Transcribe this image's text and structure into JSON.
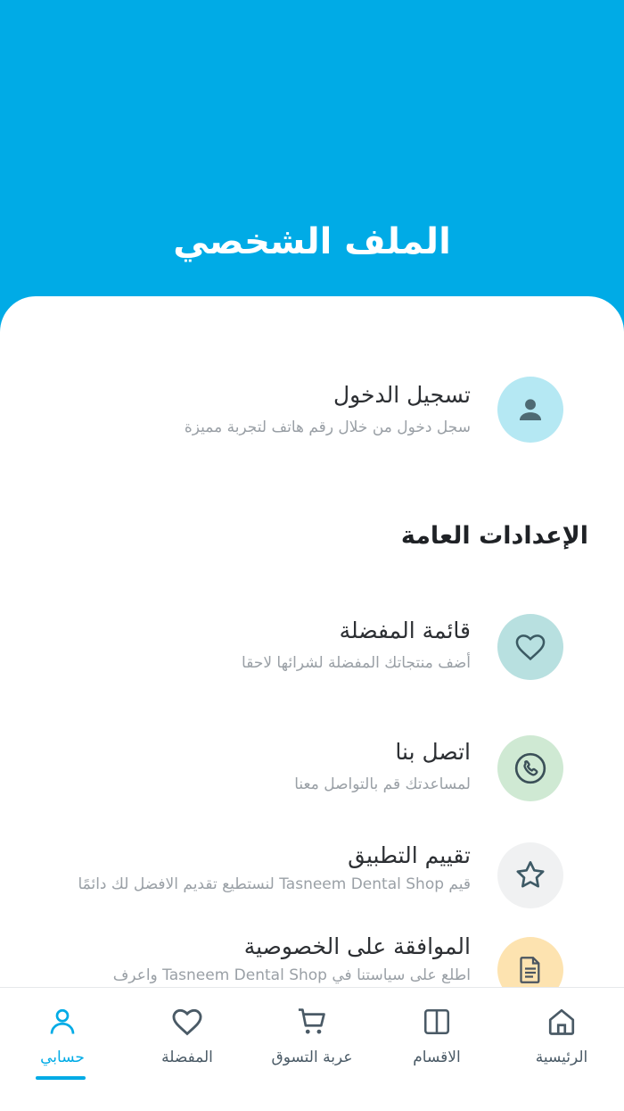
{
  "header": {
    "title": "الملف الشخصي"
  },
  "login": {
    "title": "تسجيل الدخول",
    "subtitle": "سجل دخول من خلال رقم هاتف لتجربة مميزة"
  },
  "general_settings": {
    "title": "الإعدادات العامة"
  },
  "items": [
    {
      "title": "قائمة المفضلة",
      "subtitle": "أضف منتجاتك المفضلة لشرائها لاحقا",
      "icon": "heart-icon",
      "color": "#b8e0e0"
    },
    {
      "title": "اتصل بنا",
      "subtitle": "لمساعدتك قم بالتواصل معنا",
      "icon": "phone-icon",
      "color": "#cfe9d3"
    },
    {
      "title": "تقييم التطبيق",
      "subtitle": "قيم Tasneem Dental Shop لنستطيع تقديم الافضل لك دائمًا",
      "icon": "star-icon",
      "color": "#f0f1f2"
    },
    {
      "title": "الموافقة على الخصوصية",
      "subtitle": "اطلع على سياستنا في Tasneem Dental Shop واعرف",
      "icon": "document-icon",
      "color": "#fde3b0"
    }
  ],
  "nav": {
    "home": "الرئيسية",
    "categories": "الاقسام",
    "cart": "عربة التسوق",
    "favorites": "المفضلة",
    "account": "حسابي"
  },
  "colors": {
    "primary": "#00abe6",
    "login_icon_bg": "#b5e8f3"
  }
}
